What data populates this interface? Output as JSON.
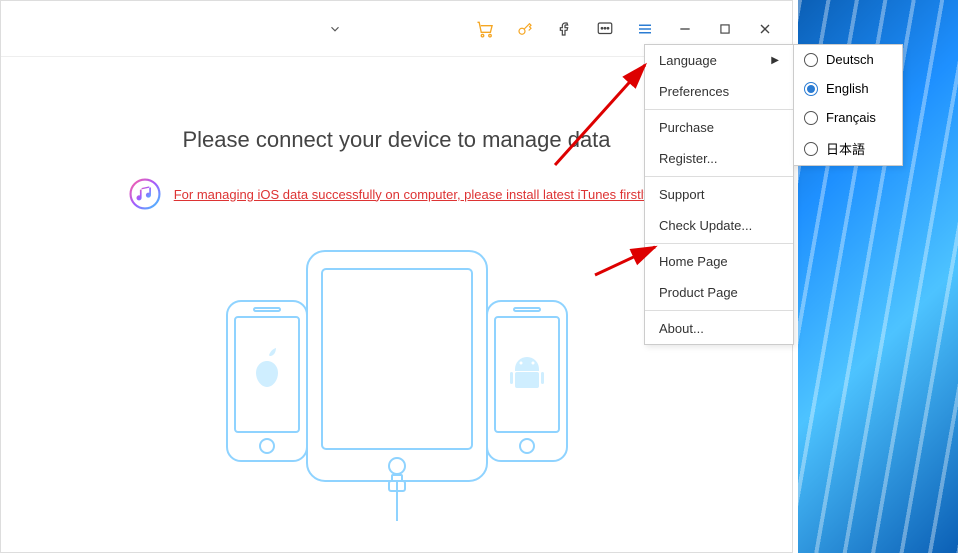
{
  "titlebar": {
    "icons": {
      "chevron": "chevron-down-icon",
      "cart": "cart-icon",
      "key": "key-icon",
      "facebook": "facebook-icon",
      "feedback": "feedback-icon",
      "hamburger": "hamburger-icon",
      "minimize": "minimize-icon",
      "maximize": "maximize-icon",
      "close": "close-icon"
    }
  },
  "main": {
    "heading": "Please connect your device to manage data",
    "itunes_link": "For managing iOS data successfully on computer, please install latest iTunes firstly>>"
  },
  "menu": {
    "language": "Language",
    "preferences": "Preferences",
    "purchase": "Purchase",
    "register": "Register...",
    "support": "Support",
    "check_update": "Check Update...",
    "home_page": "Home Page",
    "product_page": "Product Page",
    "about": "About..."
  },
  "languages": [
    {
      "label": "Deutsch",
      "selected": false
    },
    {
      "label": "English",
      "selected": true
    },
    {
      "label": "Français",
      "selected": false
    },
    {
      "label": "日本語",
      "selected": false
    }
  ]
}
